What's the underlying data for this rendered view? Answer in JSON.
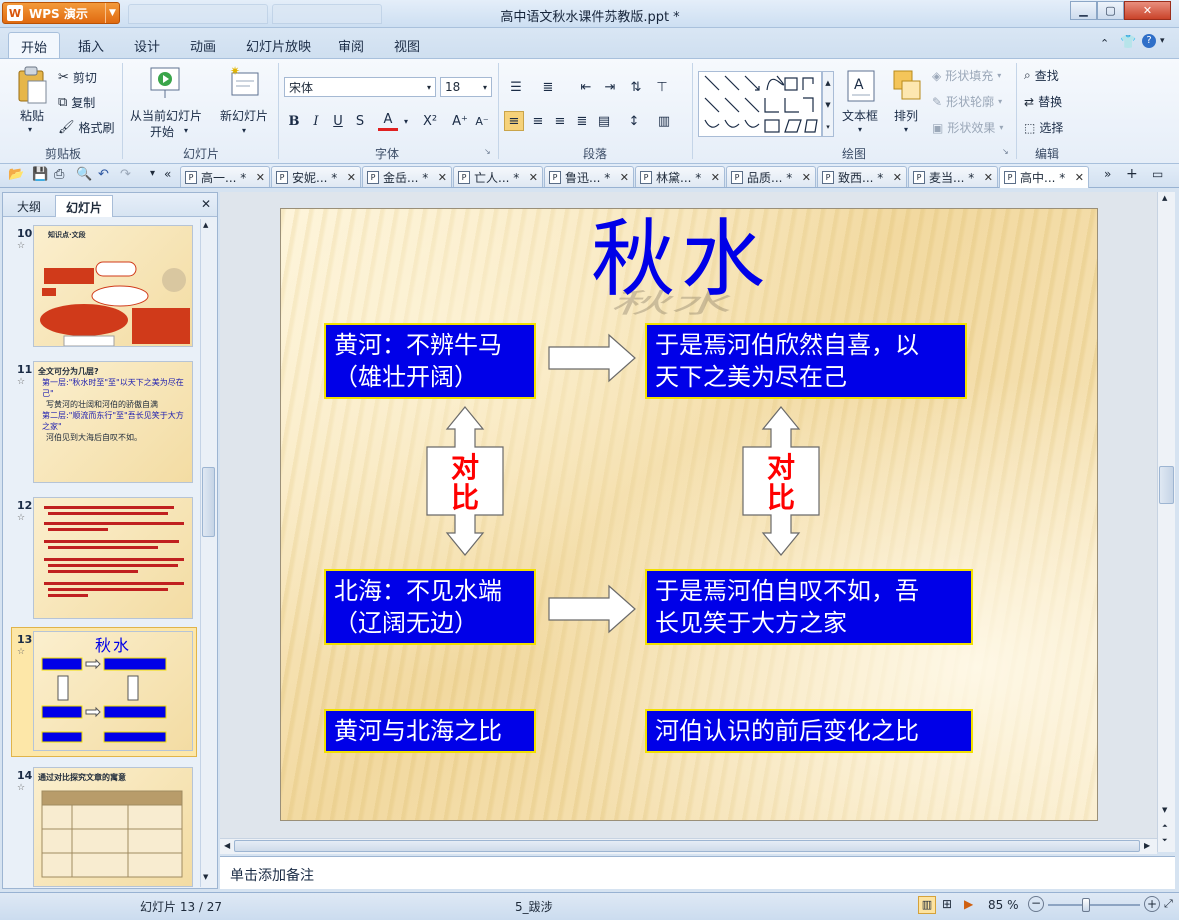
{
  "app": {
    "name": "WPS 演示",
    "window_title": "高中语文秋水课件苏教版.ppt *"
  },
  "menu_tabs": [
    "开始",
    "插入",
    "设计",
    "动画",
    "幻灯片放映",
    "审阅",
    "视图"
  ],
  "ribbon": {
    "clipboard": {
      "paste": "粘贴",
      "cut": "剪切",
      "copy": "复制",
      "format_painter": "格式刷",
      "group": "剪贴板"
    },
    "slides": {
      "from_current": "从当前幻灯片",
      "start": "开始",
      "new_slide": "新幻灯片",
      "group": "幻灯片"
    },
    "font": {
      "name": "宋体",
      "size": "18",
      "group": "字体"
    },
    "paragraph": {
      "group": "段落"
    },
    "drawing": {
      "textbox": "文本框",
      "arrange": "排列",
      "shape_fill": "形状填充",
      "shape_outline": "形状轮廓",
      "shape_effects": "形状效果",
      "group": "绘图"
    },
    "edit": {
      "find": "查找",
      "replace": "替换",
      "select": "选择",
      "group": "编辑"
    }
  },
  "doc_tabs": [
    "高一... *",
    "安妮... *",
    "金岳... *",
    "亡人... *",
    "鲁迅... *",
    "林黛... *",
    "品质... *",
    "致西... *",
    "麦当... *",
    "高中... *"
  ],
  "left_panel": {
    "tab_outline": "大纲",
    "tab_slides": "幻灯片",
    "thumbs": [
      {
        "num": "10",
        "title": "知识点·文段"
      },
      {
        "num": "11",
        "title": "全文可分为几层?",
        "lines": [
          "第一层:\"秋水时至\"至\"以天下之美为尽在己\"",
          "写黄河的壮阔和河伯的骄傲自满",
          "第二层:\"顺流而东行\"至\"吾长见笑于大方之家\"",
          "河伯见到大海后自叹不如。"
        ]
      },
      {
        "num": "12",
        "title": ""
      },
      {
        "num": "13",
        "title": "秋水"
      },
      {
        "num": "14",
        "title": "通过对比探究文章的寓意"
      }
    ]
  },
  "slide": {
    "title": "秋水",
    "box_huanghe": [
      "黄河：不辨牛马",
      "（雄壮开阔）"
    ],
    "box_hebo_joy": [
      "于是焉河伯欣然自喜，以",
      "天下之美为尽在己"
    ],
    "box_beihai": [
      "北海：不见水端",
      "（辽阔无边）"
    ],
    "box_hebo_sigh": [
      "于是焉河伯自叹不如，吾",
      "长见笑于大方之家"
    ],
    "contrast_label": [
      "对",
      "比"
    ],
    "compare_left": "黄河与北海之比",
    "compare_right": "河伯认识的前后变化之比"
  },
  "notes_placeholder": "单击添加备注",
  "status": {
    "slide_info": "幻灯片 13 / 27",
    "theme": "5_跋涉",
    "zoom": "85 %"
  },
  "colors": {
    "slide_box_blue": "#0000e8",
    "box_border": "#f2e000",
    "contrast_text": "#ff0000",
    "title_blue": "#0000e8"
  }
}
